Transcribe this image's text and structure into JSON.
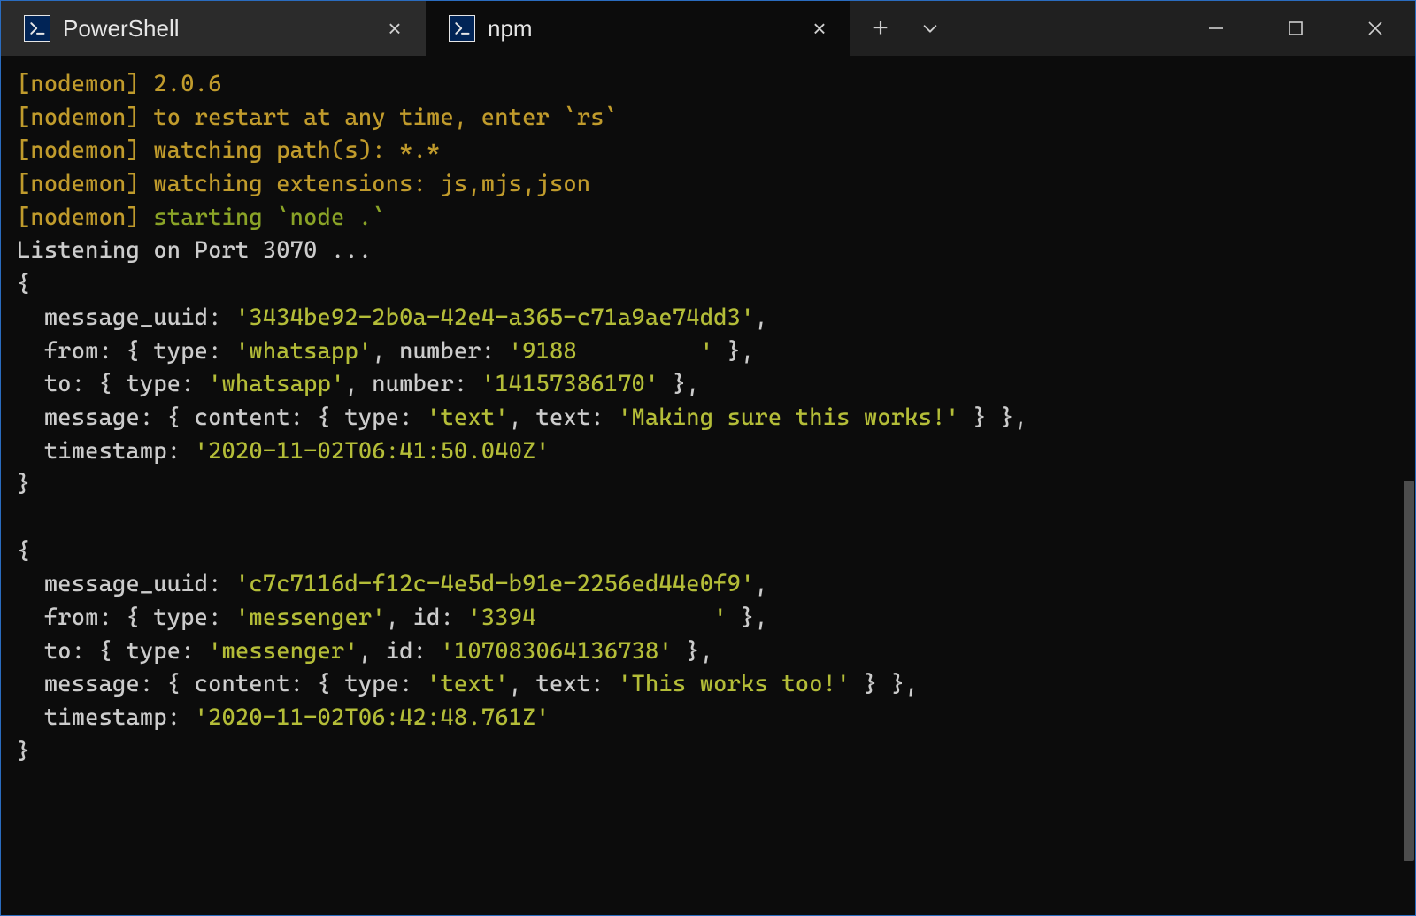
{
  "tabs": [
    {
      "label": "PowerShell",
      "active": false
    },
    {
      "label": "npm",
      "active": true
    }
  ],
  "nodemon": {
    "line1": "[nodemon] 2.0.6",
    "line2": "[nodemon] to restart at any time, enter `rs`",
    "line3": "[nodemon] watching path(s): *.*",
    "line4": "[nodemon] watching extensions: js,mjs,json",
    "line5_a": "[nodemon] ",
    "line5_b": "starting `node .`"
  },
  "listening": "Listening on Port 3070 ...",
  "obj1": {
    "open": "{",
    "uuid_k": "  message_uuid:",
    "uuid_v": " '3434be92-2b0a-42e4-a365-c71a9ae74dd3'",
    "comma": ",",
    "from_k": "  from:",
    "from_mid1": " { type: ",
    "from_type": "'whatsapp'",
    "from_mid2": ", number: ",
    "from_num": "'9188         '",
    "from_end": " },",
    "to_k": "  to:",
    "to_mid1": " { type: ",
    "to_type": "'whatsapp'",
    "to_mid2": ", number: ",
    "to_num": "'14157386170'",
    "to_end": " },",
    "msg_k": "  message:",
    "msg_mid1": " { content: { type: ",
    "msg_type": "'text'",
    "msg_mid2": ", text: ",
    "msg_text": "'Making sure this works!'",
    "msg_end": " } },",
    "ts_k": "  timestamp:",
    "ts_v": " '2020-11-02T06:41:50.040Z'",
    "close": "}"
  },
  "obj2": {
    "open": "{",
    "uuid_k": "  message_uuid:",
    "uuid_v": " 'c7c7116d-f12c-4e5d-b91e-2256ed44e0f9'",
    "comma": ",",
    "from_k": "  from:",
    "from_mid1": " { type: ",
    "from_type": "'messenger'",
    "from_mid2": ", id: ",
    "from_id": "'3394             '",
    "from_end": " },",
    "to_k": "  to:",
    "to_mid1": " { type: ",
    "to_type": "'messenger'",
    "to_mid2": ", id: ",
    "to_id": "'107083064136738'",
    "to_end": " },",
    "msg_k": "  message:",
    "msg_mid1": " { content: { type: ",
    "msg_type": "'text'",
    "msg_mid2": ", text: ",
    "msg_text": "'This works too!'",
    "msg_end": " } },",
    "ts_k": "  timestamp:",
    "ts_v": " '2020-11-02T06:42:48.761Z'",
    "close": "}"
  }
}
